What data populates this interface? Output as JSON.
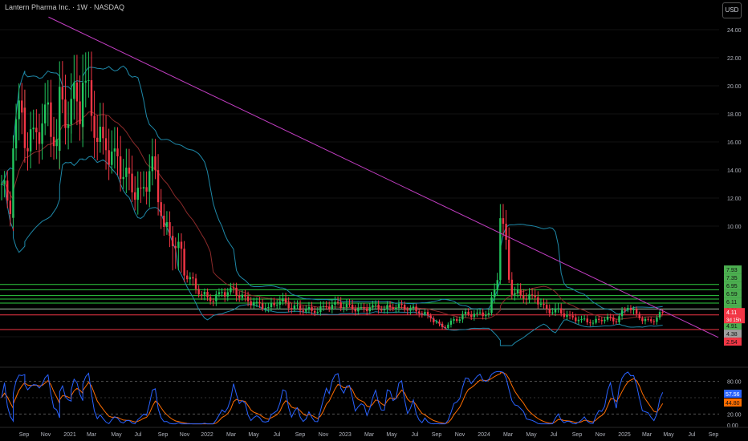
{
  "header": {
    "title": "Lantern Pharma Inc. · 1W · NASDAQ",
    "currency": "USD"
  },
  "chart_data": [
    {
      "type": "candlestick",
      "title": "Lantern Pharma Inc. · 1W · NASDAQ",
      "ylim": [
        1.0,
        26.0
      ],
      "x_labels": [
        "Sep",
        "Nov",
        "2021",
        "Mar",
        "May",
        "Jul",
        "Sep",
        "Nov",
        "2022",
        "Mar",
        "May",
        "Jul",
        "Sep",
        "Nov",
        "2023",
        "Mar",
        "May",
        "Jul",
        "Sep",
        "Nov",
        "2024",
        "Mar",
        "May",
        "Jul",
        "Sep",
        "Nov",
        "2025",
        "Mar",
        "May",
        "Jul",
        "Sep"
      ],
      "y_ticks": [
        "24.00",
        "22.00",
        "20.00",
        "18.00",
        "16.00",
        "14.00",
        "12.00",
        "10.00",
        "2.00"
      ],
      "price_labels": [
        {
          "text": "7.93",
          "value": 7.93,
          "color": "#4caf50"
        },
        {
          "text": "7.35",
          "value": 7.35,
          "color": "#4caf50"
        },
        {
          "text": "6.95",
          "value": 6.95,
          "color": "#4caf50"
        },
        {
          "text": "6.59",
          "value": 6.59,
          "color": "#4caf50"
        },
        {
          "text": "6.11",
          "value": 6.11,
          "color": "#4caf50"
        },
        {
          "text": "5.59",
          "value": 5.59,
          "color": "#4caf50"
        },
        {
          "text": "5.27",
          "value": 5.27,
          "color": "#4caf50"
        },
        {
          "text": "4.91",
          "value": 4.91,
          "color": "#4caf50"
        },
        {
          "text": "4.38",
          "value": 4.38,
          "color": "#9e9e9e"
        },
        {
          "text": "2.54",
          "value": 2.54,
          "color": "#f23645"
        }
      ],
      "last_price": {
        "value": "4.11",
        "countdown": "3d 15h",
        "color": "#f23645"
      },
      "horizontal_levels": {
        "green": [
          6.59,
          6.11,
          5.59,
          5.27,
          4.91,
          4.38
        ],
        "gray": [
          4.38
        ],
        "red": [
          2.54,
          3.85
        ]
      },
      "trendline": {
        "from": {
          "x": "2020-09",
          "y": 24.9
        },
        "to": {
          "x": "2025-05",
          "y": 3.85
        },
        "color": "#c23ec2"
      },
      "close_path": [
        {
          "x": "2020-08",
          "y": 13.0
        },
        {
          "x": "2020-09",
          "y": 11.0
        },
        {
          "x": "2020-09",
          "y": 16.5
        },
        {
          "x": "2020-10",
          "y": 19.5
        },
        {
          "x": "2020-10",
          "y": 16.0
        },
        {
          "x": "2020-11",
          "y": 16.5
        },
        {
          "x": "2020-12",
          "y": 18.0
        },
        {
          "x": "2021-01",
          "y": 14.5
        },
        {
          "x": "2021-01",
          "y": 19.0
        },
        {
          "x": "2021-02",
          "y": 17.0
        },
        {
          "x": "2021-02",
          "y": 19.5
        },
        {
          "x": "2021-03",
          "y": 18.0
        },
        {
          "x": "2021-03",
          "y": 21.5
        },
        {
          "x": "2021-04",
          "y": 17.0
        },
        {
          "x": "2021-05",
          "y": 15.5
        },
        {
          "x": "2021-06",
          "y": 14.5
        },
        {
          "x": "2021-07",
          "y": 13.0
        },
        {
          "x": "2021-08",
          "y": 12.0
        },
        {
          "x": "2021-09",
          "y": 14.5
        },
        {
          "x": "2021-10",
          "y": 10.0
        },
        {
          "x": "2021-11",
          "y": 8.8
        },
        {
          "x": "2021-12",
          "y": 7.5
        },
        {
          "x": "2022-01",
          "y": 6.0
        },
        {
          "x": "2022-02",
          "y": 5.2
        },
        {
          "x": "2022-03",
          "y": 5.8
        },
        {
          "x": "2022-04",
          "y": 6.0
        },
        {
          "x": "2022-05",
          "y": 5.2
        },
        {
          "x": "2022-06",
          "y": 4.8
        },
        {
          "x": "2022-07",
          "y": 4.5
        },
        {
          "x": "2022-08",
          "y": 5.2
        },
        {
          "x": "2022-09",
          "y": 4.6
        },
        {
          "x": "2022-10",
          "y": 4.4
        },
        {
          "x": "2022-11",
          "y": 4.2
        },
        {
          "x": "2022-12",
          "y": 4.6
        },
        {
          "x": "2023-01",
          "y": 4.8
        },
        {
          "x": "2023-02",
          "y": 4.5
        },
        {
          "x": "2023-03",
          "y": 4.3
        },
        {
          "x": "2023-04",
          "y": 4.6
        },
        {
          "x": "2023-05",
          "y": 4.4
        },
        {
          "x": "2023-06",
          "y": 4.7
        },
        {
          "x": "2023-07",
          "y": 4.5
        },
        {
          "x": "2023-08",
          "y": 4.2
        },
        {
          "x": "2023-09",
          "y": 3.6
        },
        {
          "x": "2023-10",
          "y": 2.7
        },
        {
          "x": "2023-11",
          "y": 3.3
        },
        {
          "x": "2023-12",
          "y": 3.9
        },
        {
          "x": "2024-01",
          "y": 3.9
        },
        {
          "x": "2024-02",
          "y": 4.0
        },
        {
          "x": "2024-03",
          "y": 8.5
        },
        {
          "x": "2024-03",
          "y": 11.2
        },
        {
          "x": "2024-04",
          "y": 6.0
        },
        {
          "x": "2024-05",
          "y": 5.5
        },
        {
          "x": "2024-06",
          "y": 5.4
        },
        {
          "x": "2024-07",
          "y": 4.2
        },
        {
          "x": "2024-08",
          "y": 4.2
        },
        {
          "x": "2024-09",
          "y": 3.6
        },
        {
          "x": "2024-10",
          "y": 3.4
        },
        {
          "x": "2024-11",
          "y": 3.2
        },
        {
          "x": "2024-12",
          "y": 3.6
        },
        {
          "x": "2025-01",
          "y": 3.4
        },
        {
          "x": "2025-02",
          "y": 4.7
        },
        {
          "x": "2025-03",
          "y": 3.6
        },
        {
          "x": "2025-04",
          "y": 3.2
        },
        {
          "x": "2025-05",
          "y": 4.11
        }
      ]
    },
    {
      "type": "line",
      "title": "",
      "ylim": [
        0,
        100
      ],
      "y_ticks": [
        "80.00",
        "20.00",
        "0.00"
      ],
      "series": [
        {
          "name": "",
          "color": "#2962ff",
          "last_value": "57.56"
        },
        {
          "name": "",
          "color": "#ff6d00",
          "last_value": "44.80"
        }
      ],
      "x_labels": [
        "Sep",
        "Nov",
        "2021",
        "Mar",
        "May",
        "Jul",
        "Sep",
        "Nov",
        "2022",
        "Mar",
        "May",
        "Jul",
        "Sep",
        "Nov",
        "2023",
        "Mar",
        "May",
        "Jul",
        "Sep",
        "Nov",
        "2024",
        "Mar",
        "May",
        "Jul",
        "Sep",
        "Nov",
        "2025",
        "Mar",
        "May",
        "Jul",
        "Sep"
      ]
    }
  ]
}
